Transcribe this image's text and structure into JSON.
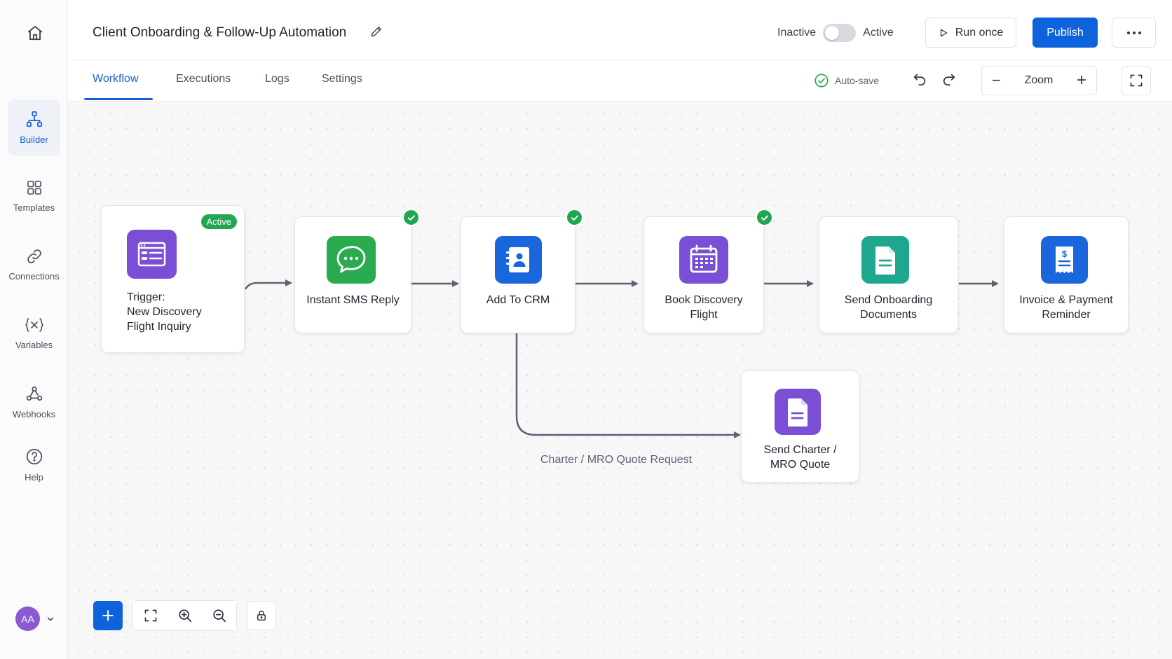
{
  "sidebar": {
    "items": [
      {
        "label": "Builder",
        "icon": "workflow-tree-icon"
      },
      {
        "label": "Templates",
        "icon": "grid-icon"
      },
      {
        "label": "Connections",
        "icon": "link-icon"
      },
      {
        "label": "Variables",
        "icon": "variables-icon"
      },
      {
        "label": "Webhooks",
        "icon": "webhook-icon"
      },
      {
        "label": "Help",
        "icon": "help-circle-icon"
      }
    ],
    "avatar_initials": "AA"
  },
  "header": {
    "title": "Client Onboarding & Follow-Up Automation",
    "toggle_off_label": "Inactive",
    "toggle_on_label": "Active",
    "run_once_label": "Run once",
    "publish_label": "Publish",
    "more_label": "···"
  },
  "tabs": [
    {
      "label": "Workflow",
      "active": true
    },
    {
      "label": "Executions",
      "active": false
    },
    {
      "label": "Logs",
      "active": false
    },
    {
      "label": "Settings",
      "active": false
    }
  ],
  "toolbar": {
    "autosave_label": "Auto-save",
    "zoom_label": "Zoom",
    "zoom_minus": "−",
    "zoom_plus": "+"
  },
  "nodes": {
    "trigger": {
      "line1": "Trigger:",
      "line2": "New Discovery",
      "line3": "Flight Inquiry",
      "badge": "Active",
      "color": "#7a4fd6"
    },
    "sms": {
      "label": "Instant SMS Reply",
      "color": "#2bab4f"
    },
    "crm": {
      "label": "Add To CRM",
      "color": "#1a67dd"
    },
    "book": {
      "line1": "Book Discovery",
      "line2": "Flight",
      "color": "#7a4fd6"
    },
    "docs": {
      "line1": "Send Onboarding",
      "line2": "Documents",
      "color": "#1fa68f"
    },
    "invoice": {
      "line1": "Invoice & Payment",
      "line2": "Reminder",
      "color": "#1a67dd"
    },
    "quote": {
      "line1": "Send Charter /",
      "line2": "MRO Quote",
      "color": "#7a4fd6"
    }
  },
  "branch_label": "Charter / MRO Quote Request",
  "colors": {
    "accent": "#0e62db",
    "success": "#21a550",
    "connector": "#5b6272"
  }
}
